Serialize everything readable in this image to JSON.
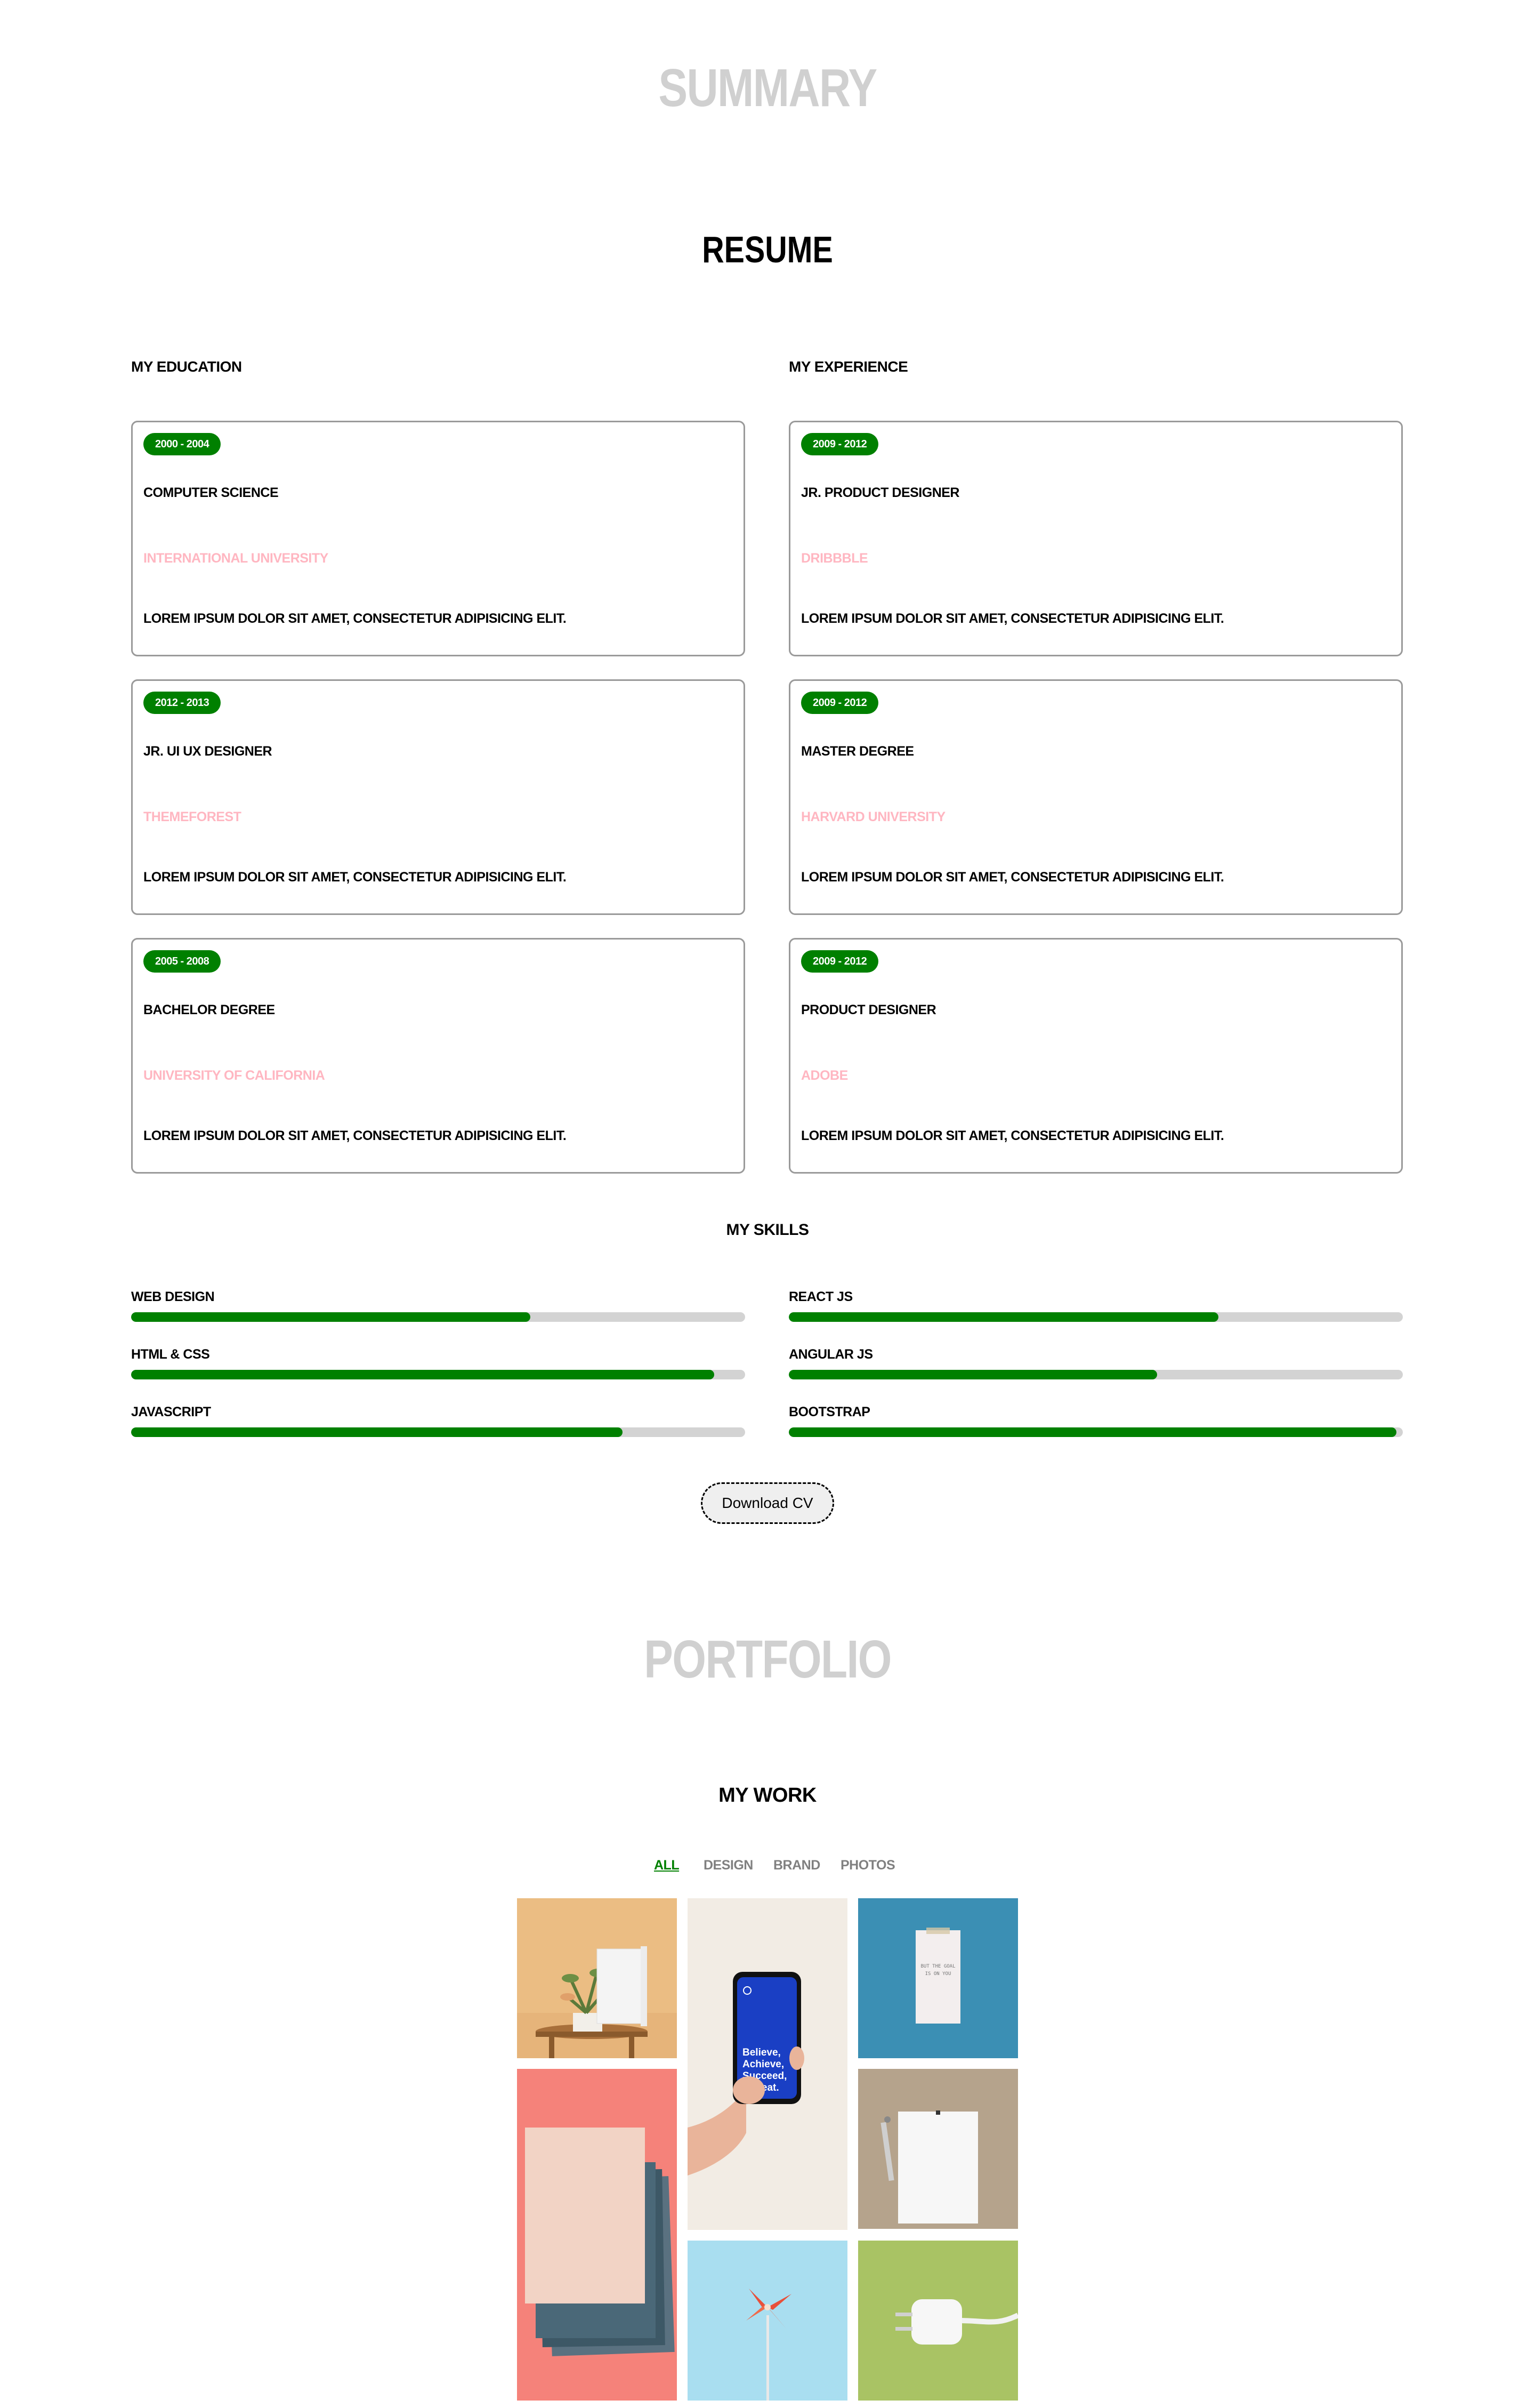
{
  "summary": {
    "ghost_title": "SUMMARY",
    "title": "RESUME"
  },
  "education": {
    "heading": "MY EDUCATION",
    "items": [
      {
        "years": "2000 - 2004",
        "title": "COMPUTER SCIENCE",
        "org": "INTERNATIONAL UNIVERSITY",
        "desc": "LOREM IPSUM DOLOR SIT AMET, CONSECTETUR ADIPISICING ELIT."
      },
      {
        "years": "2012 - 2013",
        "title": "JR. UI UX DESIGNER",
        "org": "THEMEFOREST",
        "desc": "LOREM IPSUM DOLOR SIT AMET, CONSECTETUR ADIPISICING ELIT."
      },
      {
        "years": "2005 - 2008",
        "title": "BACHELOR DEGREE",
        "org": "UNIVERSITY OF CALIFORNIA",
        "desc": "LOREM IPSUM DOLOR SIT AMET, CONSECTETUR ADIPISICING ELIT."
      }
    ]
  },
  "experience": {
    "heading": "MY EXPERIENCE",
    "items": [
      {
        "years": "2009 - 2012",
        "title": "JR. PRODUCT DESIGNER",
        "org": "DRIBBBLE",
        "desc": "LOREM IPSUM DOLOR SIT AMET, CONSECTETUR ADIPISICING ELIT."
      },
      {
        "years": "2009 - 2012",
        "title": "MASTER DEGREE",
        "org": "HARVARD UNIVERSITY",
        "desc": "LOREM IPSUM DOLOR SIT AMET, CONSECTETUR ADIPISICING ELIT."
      },
      {
        "years": "2009 - 2012",
        "title": "PRODUCT DESIGNER",
        "org": "ADOBE",
        "desc": "LOREM IPSUM DOLOR SIT AMET, CONSECTETUR ADIPISICING ELIT."
      }
    ]
  },
  "skills": {
    "heading": "MY SKILLS",
    "left": [
      {
        "label": "WEB DESIGN",
        "level": 0.65
      },
      {
        "label": "HTML & CSS",
        "level": 0.95
      },
      {
        "label": "JAVASCRIPT",
        "level": 0.8
      }
    ],
    "right": [
      {
        "label": "REACT JS",
        "level": 0.7
      },
      {
        "label": "ANGULAR JS",
        "level": 0.6
      },
      {
        "label": "BOOTSTRAP",
        "level": 0.99
      }
    ]
  },
  "download_button": "Download CV",
  "portfolio": {
    "ghost_title": "PORTFOLIO",
    "title": "MY WORK",
    "filters": [
      "ALL",
      "DESIGN",
      "BRAND",
      "PHOTOS"
    ],
    "active_filter": "ALL",
    "phone_text": "Believe, Achieve, Succeed, Repeat.",
    "note_text": "BUT THE GOAL IS ON YOU"
  },
  "colors": {
    "accent": "#008000",
    "org_text": "#ffb6c1",
    "ghost": "#d0d0d0",
    "track": "#d3d3d3"
  }
}
